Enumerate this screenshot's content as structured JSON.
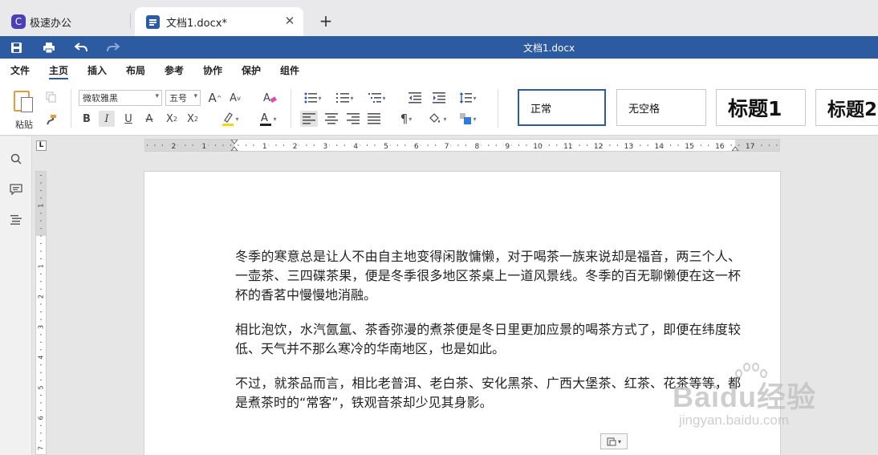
{
  "tabs": {
    "app_name": "极速办公",
    "app_logo_letter": "C",
    "doc_name": "文档1.docx*",
    "close_symbol": "✕",
    "add_symbol": "+"
  },
  "titlebar": {
    "title": "文档1.docx",
    "buttons": [
      "save-icon",
      "print-icon",
      "undo-icon",
      "redo-icon"
    ]
  },
  "menu": {
    "items": [
      "文件",
      "主页",
      "插入",
      "布局",
      "参考",
      "协作",
      "保护",
      "组件"
    ],
    "active": "主页"
  },
  "ribbon": {
    "paste_label": "粘贴",
    "font_name": "微软雅黑",
    "font_size": "五号",
    "grow_font": "A",
    "shrink_font": "A",
    "bold": "B",
    "italic": "I",
    "underline": "U",
    "strike": "A",
    "superscript": "X",
    "subscript": "X",
    "highlight": "A",
    "font_color": "A",
    "paragraph_mark": "¶",
    "styles": [
      "正常",
      "无空格",
      "标题1",
      "标题2"
    ],
    "highlight_color": "#f5d90a",
    "font_color_value": "#222222"
  },
  "rulers": {
    "corner": "L",
    "h_labels": [
      "2",
      "1",
      "1",
      "2",
      "3",
      "4",
      "5",
      "6",
      "7",
      "8",
      "9",
      "10",
      "11",
      "12",
      "13",
      "14",
      "15",
      "16",
      "17"
    ],
    "v_labels": [
      "1",
      "1",
      "2",
      "3",
      "4",
      "5",
      "6",
      "7"
    ]
  },
  "document": {
    "paragraphs": [
      "冬季的寒意总是让人不由自主地变得闲散慵懒，对于喝茶一族来说却是福音，两三个人、一壶茶、三四碟茶果，便是冬季很多地区茶桌上一道风景线。冬季的百无聊懒便在这一杯杯的香茗中慢慢地消融。",
      "相比泡饮，水汽氤氲、茶香弥漫的煮茶便是冬日里更加应景的喝茶方式了，即便在纬度较低、天气并不那么寒冷的华南地区，也是如此。",
      "不过，就茶品而言，相比老普洱、老白茶、安化黑茶、广西大堡茶、红茶、花茶等等，都是煮茶时的“常客”，铁观音茶却少见其身影。"
    ]
  },
  "watermark": {
    "main": "Baidu经验",
    "sub": "jingyan.baidu.com"
  },
  "colors": {
    "brand_blue": "#2d5ba2",
    "app_logo": "#4a3fb5"
  }
}
